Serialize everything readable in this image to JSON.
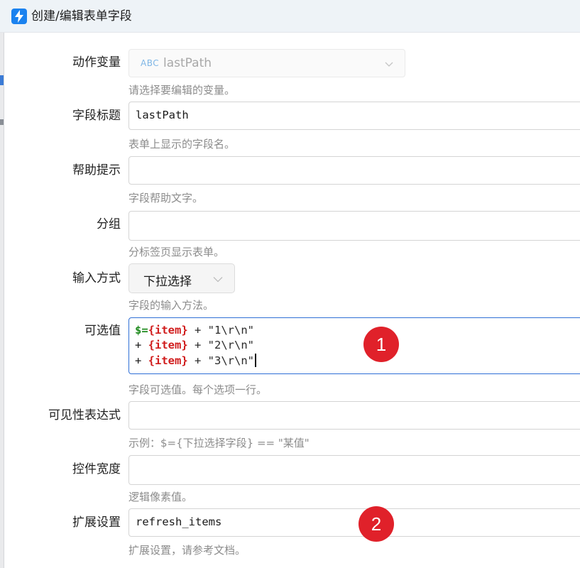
{
  "window": {
    "title": "创建/编辑表单字段"
  },
  "form": {
    "action_variable": {
      "label": "动作变量",
      "type_badge": "ABC",
      "value": "lastPath",
      "hint": "请选择要编辑的变量。"
    },
    "field_title": {
      "label": "字段标题",
      "value": "lastPath",
      "hint": "表单上显示的字段名。"
    },
    "help_tip": {
      "label": "帮助提示",
      "value": "",
      "hint": "字段帮助文字。"
    },
    "group": {
      "label": "分组",
      "value": "",
      "hint": "分标签页显示表单。"
    },
    "input_mode": {
      "label": "输入方式",
      "value": "下拉选择",
      "hint": "字段的输入方法。"
    },
    "options": {
      "label": "可选值",
      "lines": [
        {
          "prefix": "$=",
          "var": "{item}",
          "rest": " + \"1\\r\\n\""
        },
        {
          "prefix": "+ ",
          "var": "{item}",
          "rest": " + \"2\\r\\n\""
        },
        {
          "prefix": "+ ",
          "var": "{item}",
          "rest": " + \"3\\r\\n\""
        }
      ],
      "hint": "字段可选值。每个选项一行。"
    },
    "visibility": {
      "label": "可见性表达式",
      "value": "",
      "hint": "示例：$={下拉选择字段} == \"某值\""
    },
    "width": {
      "label": "控件宽度",
      "value": "",
      "hint": "逻辑像素值。"
    },
    "extension": {
      "label": "扩展设置",
      "value": "refresh_items",
      "hint": "扩展设置，请参考文档。"
    }
  },
  "annotations": {
    "badge1": "1",
    "badge2": "2"
  },
  "colors": {
    "accent": "#2f6fd6",
    "badge": "#e0212a",
    "code_var": "#d01c1c",
    "code_prefix": "#1e8a1e"
  }
}
